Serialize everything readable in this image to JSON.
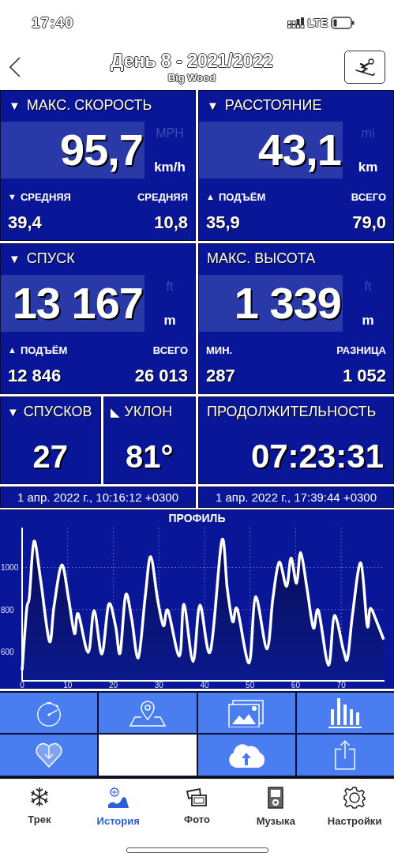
{
  "status_bar": {
    "time": "17:40",
    "network": "LTE"
  },
  "header": {
    "title": "День 8 - 2021/2022",
    "subtitle": "Big Wood"
  },
  "panels": [
    {
      "kind": "big",
      "title": "МАКС. СКОРОСТЬ",
      "title_marker": "▼",
      "value": "95,7",
      "unit_inactive": "MPH",
      "unit": "km/h",
      "stats": [
        {
          "label": "СРЕДНЯЯ",
          "marker": "▼",
          "value": "39,4"
        },
        {
          "label": "СРЕДНЯЯ",
          "value": "10,8"
        }
      ]
    },
    {
      "kind": "big",
      "title": "РАССТОЯНИЕ",
      "title_marker": "▼",
      "value": "43,1",
      "unit_inactive": "mi",
      "unit": "km",
      "stats": [
        {
          "label": "ПОДЪЁМ",
          "marker": "▲",
          "value": "35,9"
        },
        {
          "label": "ВСЕГО",
          "value": "79,0"
        }
      ]
    },
    {
      "kind": "big",
      "title": "СПУСК",
      "title_marker": "▼",
      "value": "13 167",
      "unit_inactive": "ft",
      "unit": "m",
      "stats": [
        {
          "label": "ПОДЪЁМ",
          "marker": "▲",
          "value": "12 846"
        },
        {
          "label": "ВСЕГО",
          "value": "26 013"
        }
      ]
    },
    {
      "kind": "big",
      "title": "МАКС. ВЫСОТА",
      "value": "1 339",
      "unit_inactive": "ft",
      "unit": "m",
      "stats": [
        {
          "label": "МИН.",
          "value": "287"
        },
        {
          "label": "РАЗНИЦА",
          "value": "1 052"
        }
      ]
    },
    {
      "kind": "small",
      "title": "СПУСКОВ",
      "title_marker": "▼",
      "value": "27"
    },
    {
      "kind": "small",
      "title": "УКЛОН",
      "title_marker": "◣",
      "value": "81°"
    },
    {
      "kind": "wide",
      "title": "ПРОДОЛЖИТЕЛЬНОСТЬ",
      "value": "07:23:31"
    }
  ],
  "dates": [
    "1 апр. 2022 г., 10:16:12 +0300",
    "1 апр. 2022 г., 17:39:44 +0300"
  ],
  "profile": {
    "chart_data": {
      "type": "area",
      "title": "ПРОФИЛЬ",
      "xticks": [
        0,
        10,
        20,
        30,
        40,
        50,
        60,
        70
      ],
      "yticks": [
        600,
        800,
        1000
      ],
      "grid": true,
      "xlim": [
        0,
        79.5
      ],
      "ylim": [
        460,
        1190
      ],
      "x": [
        0,
        1,
        1.6,
        2.6,
        4,
        6,
        7,
        8.7,
        10.2,
        11.5,
        12.3,
        14.5,
        15.8,
        17.5,
        19,
        20.5,
        21.5,
        22.7,
        24,
        25.5,
        27,
        28.2,
        29.7,
        31,
        32,
        34.5,
        35.5,
        37.5,
        39,
        41.3,
        43.8,
        45,
        46.2,
        47.2,
        49.8,
        51.2,
        53.7,
        55,
        56.4,
        58,
        59,
        60.2,
        61.1,
        62.5,
        63.9,
        65,
        67.2,
        68.5,
        70.5,
        71.4,
        72.5,
        74.3,
        75.7,
        76.4,
        78,
        79.3
      ],
      "series": [
        {
          "color": "#ffffff",
          "values": [
            510,
            800,
            860,
            1125,
            950,
            648,
            815,
            1012,
            850,
            685,
            780,
            595,
            795,
            588,
            825,
            720,
            592,
            868,
            760,
            570,
            860,
            1052,
            850,
            722,
            795,
            578,
            825,
            552,
            820,
            600,
            1128,
            900,
            742,
            802,
            545,
            860,
            612,
            850,
            1025,
            910,
            1045,
            925,
            1070,
            900,
            712,
            795,
            535,
            770,
            605,
            568,
            780,
            1022,
            722,
            805,
            730,
            657
          ]
        }
      ]
    }
  },
  "actions": [
    {
      "kind": "button"
    },
    {
      "kind": "button"
    },
    {
      "kind": "button"
    },
    {
      "kind": "button"
    },
    {
      "kind": "button"
    },
    {
      "kind": "blank"
    },
    {
      "kind": "button"
    },
    {
      "kind": "button"
    }
  ],
  "tabs": [
    {
      "label": "Трек",
      "selected": false
    },
    {
      "label": "История",
      "selected": true
    },
    {
      "label": "Фото",
      "selected": false
    },
    {
      "label": "Музыка",
      "selected": false
    },
    {
      "label": "Настройки",
      "selected": false
    }
  ]
}
